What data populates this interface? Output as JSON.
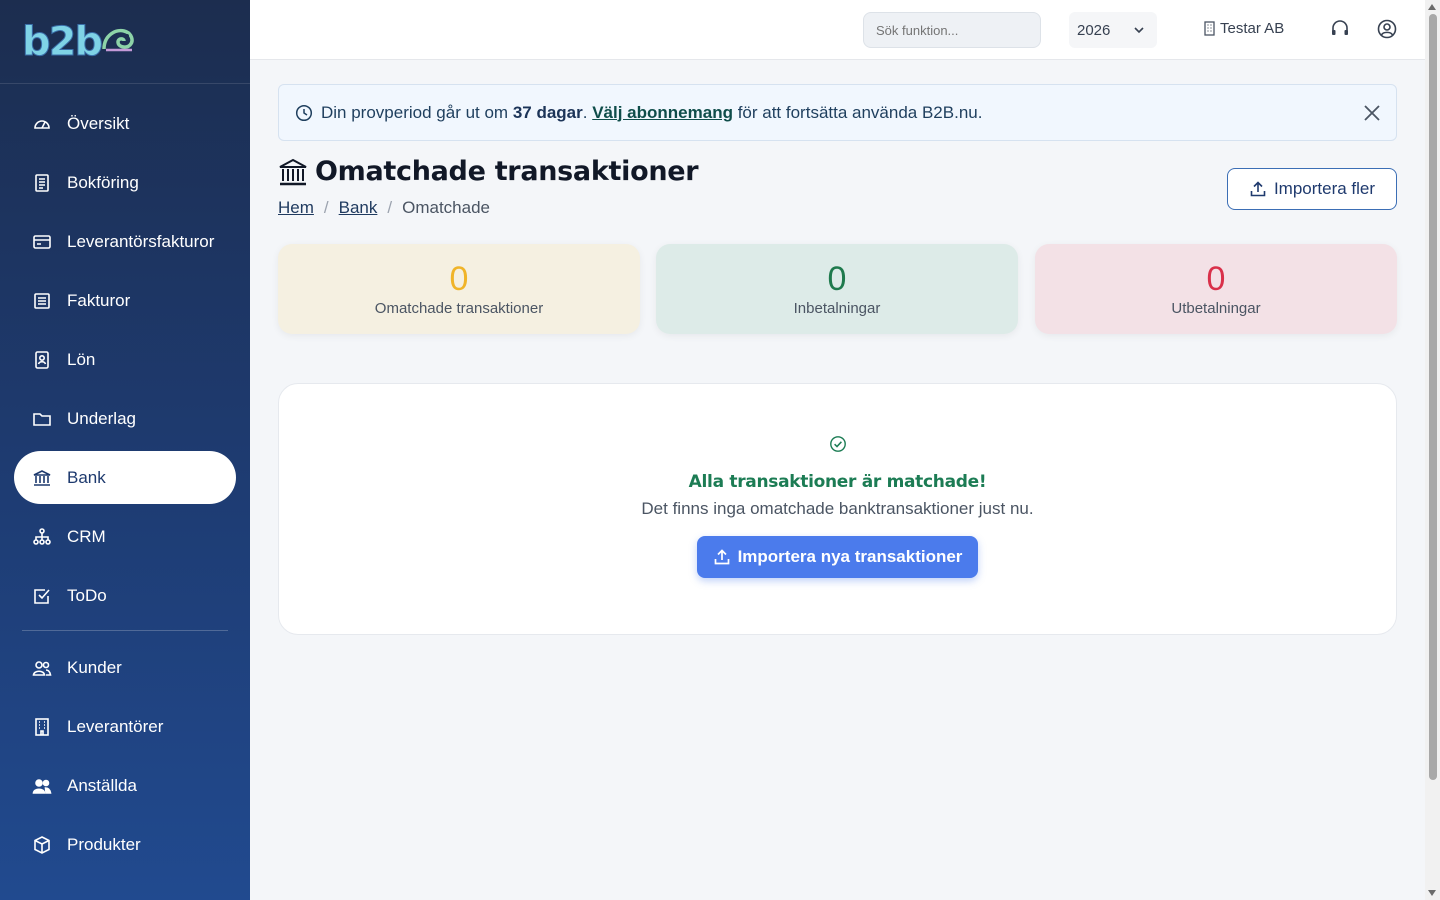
{
  "logo": {
    "text": "b2b"
  },
  "sidebar": {
    "items": [
      {
        "label": "Översikt",
        "icon": "dashboard-gauge-icon"
      },
      {
        "label": "Bokföring",
        "icon": "ledger-icon"
      },
      {
        "label": "Leverantörsfakturor",
        "icon": "credit-card-icon"
      },
      {
        "label": "Fakturor",
        "icon": "invoice-icon"
      },
      {
        "label": "Lön",
        "icon": "payroll-badge-icon"
      },
      {
        "label": "Underlag",
        "icon": "folder-icon"
      },
      {
        "label": "Bank",
        "icon": "bank-icon",
        "active": true
      },
      {
        "label": "CRM",
        "icon": "network-icon"
      },
      {
        "label": "ToDo",
        "icon": "checkbox-icon"
      }
    ],
    "secondary": [
      {
        "label": "Kunder",
        "icon": "customers-icon"
      },
      {
        "label": "Leverantörer",
        "icon": "building-icon"
      },
      {
        "label": "Anställda",
        "icon": "employees-icon"
      },
      {
        "label": "Produkter",
        "icon": "box-icon"
      }
    ]
  },
  "topbar": {
    "search_placeholder": "Sök funktion...",
    "year": "2026",
    "company": "Testar AB"
  },
  "alert": {
    "prefix": "Din provperiod går ut om ",
    "days": "37 dagar",
    "mid": ". ",
    "link": "Välj abonnemang",
    "suffix": " för att fortsätta använda B2B.nu."
  },
  "header": {
    "title": "Omatchade transaktioner",
    "breadcrumb": [
      "Hem",
      "Bank",
      "Omatchade"
    ],
    "import_more": "Importera fler"
  },
  "stats": [
    {
      "value": "0",
      "label": "Omatchade transaktioner",
      "color": "#f0b429"
    },
    {
      "value": "0",
      "label": "Inbetalningar",
      "color": "#1f7a4d"
    },
    {
      "value": "0",
      "label": "Utbetalningar",
      "color": "#d9304a"
    }
  ],
  "empty_state": {
    "title": "Alla transaktioner är matchade!",
    "description": "Det finns inga omatchade banktransaktioner just nu.",
    "button": "Importera nya transaktioner"
  },
  "colors": {
    "sidebar_top": "#1c2d4f",
    "sidebar_bottom": "#214a8f",
    "primary": "#4b7bec",
    "success": "#1c7c54"
  }
}
